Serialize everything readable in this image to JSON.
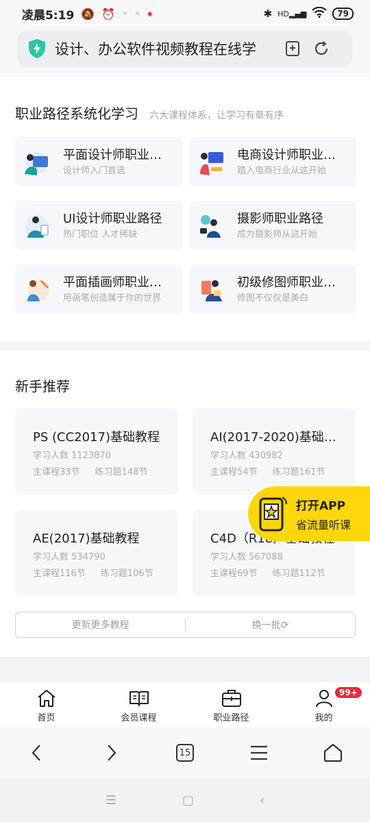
{
  "status": {
    "time": "凌晨5:19",
    "battery": "79",
    "network": "HD"
  },
  "address": {
    "url_text": "设计、办公软件视频教程在线学"
  },
  "career": {
    "title": "职业路径系统化学习",
    "subtitle": "六大课程体系，让学习有章有序",
    "paths": [
      {
        "title": "平面设计师职业…",
        "desc": "设计师入门首选"
      },
      {
        "title": "电商设计师职业…",
        "desc": "踏入电商行业从这开始"
      },
      {
        "title": "UI设计师职业路径",
        "desc": "热门职位 人才稀缺"
      },
      {
        "title": "摄影师职业路径",
        "desc": "成为摄影师从这开始"
      },
      {
        "title": "平面插画师职业…",
        "desc": "用画笔创造属于你的世界"
      },
      {
        "title": "初级修图师职业…",
        "desc": "修图不仅仅是美白"
      }
    ]
  },
  "beginner": {
    "title": "新手推荐",
    "courses": [
      {
        "title": "PS (CC2017)基础教程",
        "learners": "学习人数 1123870",
        "lessons": "主课程33节",
        "exercises": "练习题148节"
      },
      {
        "title": "AI(2017-2020)基础…",
        "learners": "学习人数 430982",
        "lessons": "主课程54节",
        "exercises": "练习题161节"
      },
      {
        "title": "AE(2017)基础教程",
        "learners": "学习人数 534790",
        "lessons": "主课程116节",
        "exercises": "练习题106节"
      },
      {
        "title": "C4D（R18）基础教程",
        "learners": "学习人数 567088",
        "lessons": "主课程69节",
        "exercises": "练习题112节"
      }
    ],
    "more_label": "更新更多教程",
    "refresh_label": "换一批"
  },
  "promo": {
    "line1": "打开APP",
    "line2": "省流量听课"
  },
  "tabs": [
    {
      "label": "首页"
    },
    {
      "label": "会员课程"
    },
    {
      "label": "职业路径"
    },
    {
      "label": "我的",
      "badge": "99+"
    }
  ],
  "browser": {
    "tab_count": "15"
  },
  "colors": {
    "accent": "#2fc6a6",
    "promo": "#ffd60a",
    "badge": "#f0283c"
  }
}
